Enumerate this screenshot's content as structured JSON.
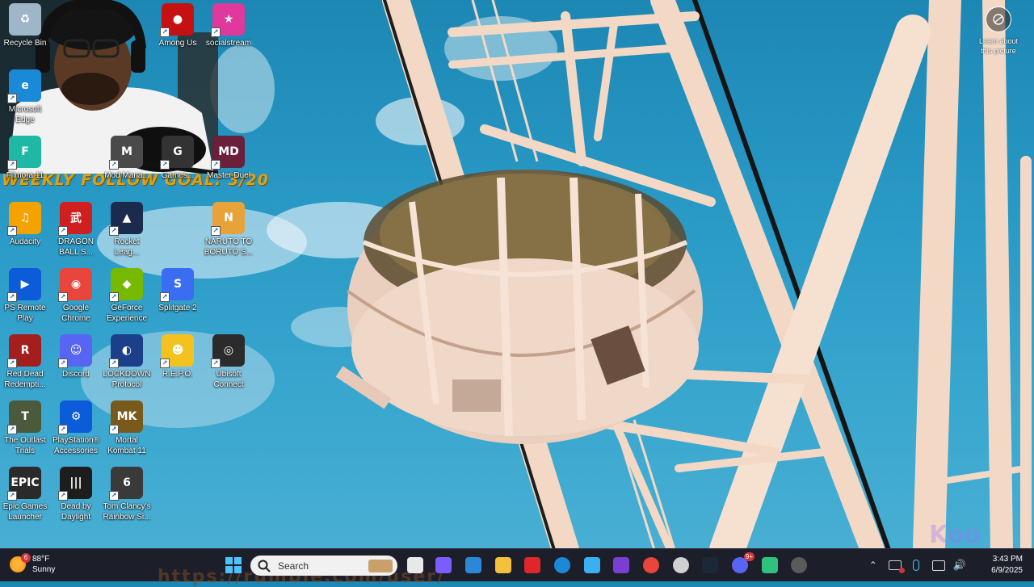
{
  "overlay": {
    "stream_goal": "WEEKLY FOLLOW GOAL: 3/20",
    "url_watermark": "https://rumble.com/user/"
  },
  "learn_more": {
    "label": "Learn about this picture",
    "icon": "camera-icon"
  },
  "desktop_icons": [
    {
      "label": "Recycle Bin",
      "icon": "recycle-bin-icon",
      "color": "#9fb6c9"
    },
    {
      "label": "Among Us",
      "icon": "among-us-icon",
      "color": "#c51111"
    },
    {
      "label": "socialstream",
      "icon": "socialstream-icon",
      "color": "#e0389c"
    },
    {
      "label": "Microsoft Edge",
      "icon": "edge-icon",
      "color": "#1a8ad8"
    },
    {
      "label": "Filmora 11",
      "icon": "filmora-icon",
      "color": "#1fb8a5"
    },
    {
      "label": "Mod Mana...",
      "icon": "mod-manager-icon",
      "color": "#4a4a4a"
    },
    {
      "label": "Games...",
      "icon": "games-icon",
      "color": "#333333"
    },
    {
      "label": "Master Duel",
      "icon": "master-duel-icon",
      "color": "#6a1f3a"
    },
    {
      "label": "Audacity",
      "icon": "audacity-icon",
      "color": "#f3a200"
    },
    {
      "label": "DRAGON BALL S...",
      "icon": "dragon-ball-icon",
      "color": "#d01f1f"
    },
    {
      "label": "Rocket Leag...",
      "icon": "rocket-league-icon",
      "color": "#1b2b4d"
    },
    {
      "label": "NARUTO TO BORUTO S...",
      "icon": "naruto-icon",
      "color": "#e8a23a"
    },
    {
      "label": "PS Remote Play",
      "icon": "ps-remote-icon",
      "color": "#0c5bd9"
    },
    {
      "label": "Google Chrome",
      "icon": "chrome-icon",
      "color": "#e8453c"
    },
    {
      "label": "GeForce Experience",
      "icon": "geforce-icon",
      "color": "#76b900"
    },
    {
      "label": "Splitgate 2",
      "icon": "splitgate-icon",
      "color": "#3b6df2"
    },
    {
      "label": "Red Dead Redempti...",
      "icon": "red-dead-icon",
      "color": "#a51e1e"
    },
    {
      "label": "Discord",
      "icon": "discord-icon",
      "color": "#5865f2"
    },
    {
      "label": "LOCKDOWN Protocol",
      "icon": "lockdown-icon",
      "color": "#1c3f8a"
    },
    {
      "label": "R.E.P.O.",
      "icon": "repo-icon",
      "color": "#f4c21e"
    },
    {
      "label": "Ubisoft Connect",
      "icon": "ubisoft-icon",
      "color": "#2b2b2b"
    },
    {
      "label": "The Outlast Trials",
      "icon": "outlast-icon",
      "color": "#4a5a3a"
    },
    {
      "label": "PlayStation® Accessories",
      "icon": "ps-accessories-icon",
      "color": "#0c5bd9"
    },
    {
      "label": "Mortal Kombat 11",
      "icon": "mortal-kombat-icon",
      "color": "#7a5a1a"
    },
    {
      "label": "Epic Games Launcher",
      "icon": "epic-games-icon",
      "color": "#2a2a2a"
    },
    {
      "label": "Dead by Daylight",
      "icon": "dead-by-daylight-icon",
      "color": "#1d1d1d"
    },
    {
      "label": "Tom Clancy's Rainbow Si...",
      "icon": "rainbow-six-icon",
      "color": "#3a3a3a"
    }
  ],
  "taskbar": {
    "weather": {
      "temp": "88°F",
      "condition": "Sunny",
      "badge": "6"
    },
    "search_placeholder": "Search",
    "pinned": [
      {
        "name": "start",
        "icon": "windows-start-icon"
      },
      {
        "name": "task-view",
        "icon": "task-view-icon"
      },
      {
        "name": "copilot",
        "icon": "copilot-icon"
      },
      {
        "name": "store",
        "icon": "store-icon"
      },
      {
        "name": "file-explorer",
        "icon": "folder-icon"
      },
      {
        "name": "app-red",
        "icon": "red-diamond-icon"
      },
      {
        "name": "edge",
        "icon": "edge-icon"
      },
      {
        "name": "weather-app",
        "icon": "weather-app-icon"
      },
      {
        "name": "app-purple",
        "icon": "purple-app-icon"
      },
      {
        "name": "chrome",
        "icon": "chrome-icon"
      },
      {
        "name": "obs",
        "icon": "obs-icon"
      },
      {
        "name": "steam",
        "icon": "steam-icon"
      },
      {
        "name": "discord",
        "icon": "discord-icon"
      },
      {
        "name": "app-green",
        "icon": "green-app-icon"
      },
      {
        "name": "media-player",
        "icon": "media-player-icon"
      }
    ],
    "discord_badge": "9+",
    "time": "3:43 PM",
    "date": "6/9/2025"
  }
}
